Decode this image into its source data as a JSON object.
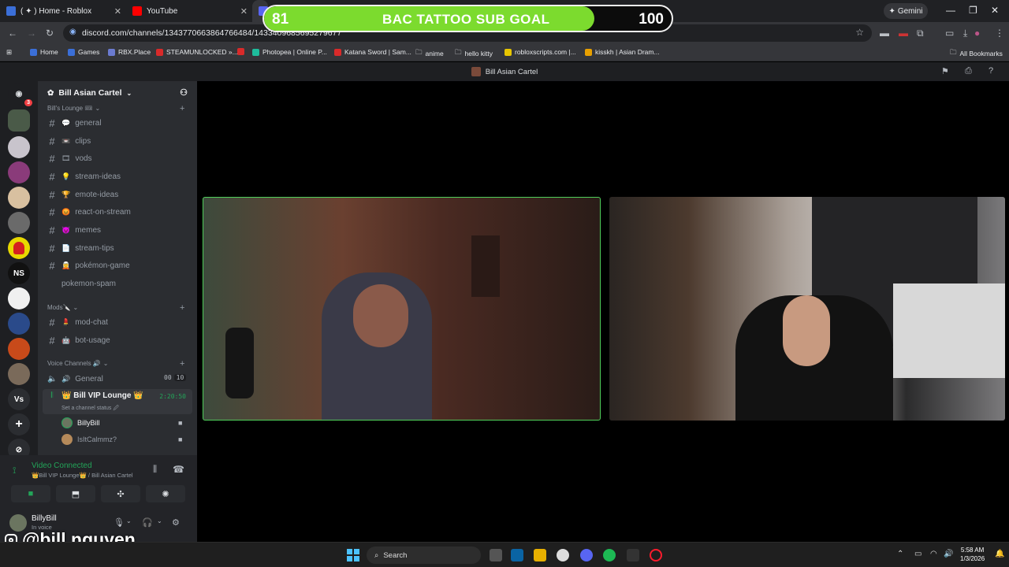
{
  "browser": {
    "tabs": [
      {
        "title": "( ✦ ) Home - Roblox",
        "icon": "roblox-icon",
        "color": "#3b6fd8"
      },
      {
        "title": "YouTube",
        "icon": "youtube-icon",
        "color": "#ff0000"
      },
      {
        "title": "",
        "icon": "discord-icon",
        "color": "#5865f2"
      }
    ],
    "gemini_label": "Gemini",
    "url": "discord.com/channels/1343770663864766484/1433409685695279677",
    "bookmarks": [
      {
        "label": "Home",
        "color": "#3b6fd8"
      },
      {
        "label": "Games",
        "color": "#3b6fd8"
      },
      {
        "label": "RBX.Place",
        "color": "#6b7bd0"
      },
      {
        "label": "STEAMUNLOCKED »...",
        "color": "#d92a2a"
      },
      {
        "label": "",
        "color": "#d92a2a"
      },
      {
        "label": "Photopea | Online P...",
        "color": "#1ebc9c"
      },
      {
        "label": "Katana Sword | Sam...",
        "color": "#d92a2a"
      },
      {
        "label": "anime",
        "color": "folder"
      },
      {
        "label": "hello kitty",
        "color": "folder"
      },
      {
        "label": "robloxscripts.com |...",
        "color": "#e8c600"
      },
      {
        "label": "kisskh | Asian Dram...",
        "color": "#e8a000"
      }
    ],
    "all_bookmarks": "All Bookmarks"
  },
  "discord": {
    "window_title": "Bill Asian Cartel",
    "server_name": "Bill Asian Cartel",
    "guild_badge": "3",
    "guild_text_ns": "NS",
    "guild_text_vs": "Vs",
    "categories": {
      "lounge": "Bill's Lounge 🎟",
      "mods": "Mods🔪",
      "voice": "Voice Channels 🔊"
    },
    "channels": [
      {
        "name": "general",
        "emoji": "💬"
      },
      {
        "name": "clips",
        "emoji": "📼"
      },
      {
        "name": "vods",
        "emoji": "🎞"
      },
      {
        "name": "stream-ideas",
        "emoji": "💡"
      },
      {
        "name": "emote-ideas",
        "emoji": "🏆"
      },
      {
        "name": "react-on-stream",
        "emoji": "😡"
      },
      {
        "name": "memes",
        "emoji": "😈"
      },
      {
        "name": "stream-tips",
        "emoji": "📄"
      },
      {
        "name": "pokémon-game",
        "emoji": "🧝"
      },
      {
        "name": "pokemon-spam",
        "emoji": ""
      }
    ],
    "mod_channels": [
      {
        "name": "mod-chat",
        "emoji": "💄"
      },
      {
        "name": "bot-usage",
        "emoji": "🤖"
      }
    ],
    "voice_general": {
      "name": "General",
      "count_a": "00",
      "count_b": "10"
    },
    "voice_vip": {
      "name": "👑 Bill VIP Lounge 👑",
      "timer": "2:20:50",
      "status": "Set a channel status 🖉"
    },
    "members": [
      "BillyBill",
      "IsItCalmmz?"
    ],
    "voice_panel": {
      "status": "Video Connected",
      "location": "👑Bill VIP Lounge👑 / Bill Asian Cartel"
    },
    "user": {
      "name": "BillyBill",
      "status": "In voice"
    }
  },
  "overlay": {
    "goal_current": 81,
    "goal_target": 100,
    "goal_title": "BAC TATTOO SUB GOAL",
    "goal_fill_color": "#7cdb2e",
    "instagram_handle": "@bill.nguyen"
  },
  "taskbar": {
    "search_placeholder": "Search",
    "time": "5:58 AM",
    "date": "1/3/2026"
  }
}
